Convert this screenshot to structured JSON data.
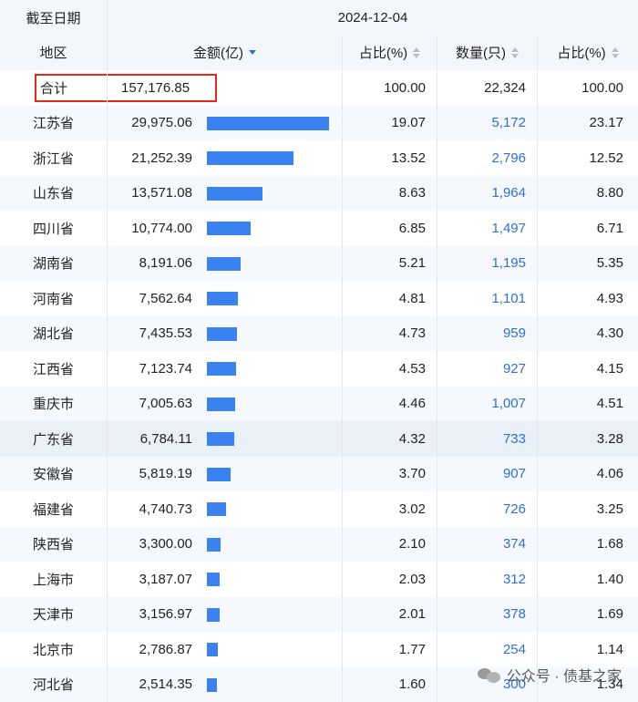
{
  "header": {
    "date_label": "截至日期",
    "date_value": "2024-12-04",
    "col_region": "地区",
    "col_amount": "金额(亿)",
    "col_share1": "占比(%)",
    "col_count": "数量(只)",
    "col_share2": "占比(%)"
  },
  "total": {
    "label": "合计",
    "amount": "157,176.85",
    "share1": "100.00",
    "count": "22,324",
    "share2": "100.00"
  },
  "bar_color": "#3a82f0",
  "rows": [
    {
      "region": "江苏省",
      "amount": "29,975.06",
      "amount_num": 29975.06,
      "share1": "19.07",
      "count": "5,172",
      "share2": "23.17"
    },
    {
      "region": "浙江省",
      "amount": "21,252.39",
      "amount_num": 21252.39,
      "share1": "13.52",
      "count": "2,796",
      "share2": "12.52"
    },
    {
      "region": "山东省",
      "amount": "13,571.08",
      "amount_num": 13571.08,
      "share1": "8.63",
      "count": "1,964",
      "share2": "8.80"
    },
    {
      "region": "四川省",
      "amount": "10,774.00",
      "amount_num": 10774.0,
      "share1": "6.85",
      "count": "1,497",
      "share2": "6.71"
    },
    {
      "region": "湖南省",
      "amount": "8,191.06",
      "amount_num": 8191.06,
      "share1": "5.21",
      "count": "1,195",
      "share2": "5.35"
    },
    {
      "region": "河南省",
      "amount": "7,562.64",
      "amount_num": 7562.64,
      "share1": "4.81",
      "count": "1,101",
      "share2": "4.93"
    },
    {
      "region": "湖北省",
      "amount": "7,435.53",
      "amount_num": 7435.53,
      "share1": "4.73",
      "count": "959",
      "share2": "4.30"
    },
    {
      "region": "江西省",
      "amount": "7,123.74",
      "amount_num": 7123.74,
      "share1": "4.53",
      "count": "927",
      "share2": "4.15"
    },
    {
      "region": "重庆市",
      "amount": "7,005.63",
      "amount_num": 7005.63,
      "share1": "4.46",
      "count": "1,007",
      "share2": "4.51"
    },
    {
      "region": "广东省",
      "amount": "6,784.11",
      "amount_num": 6784.11,
      "share1": "4.32",
      "count": "733",
      "share2": "3.28"
    },
    {
      "region": "安徽省",
      "amount": "5,819.19",
      "amount_num": 5819.19,
      "share1": "3.70",
      "count": "907",
      "share2": "4.06"
    },
    {
      "region": "福建省",
      "amount": "4,740.73",
      "amount_num": 4740.73,
      "share1": "3.02",
      "count": "726",
      "share2": "3.25"
    },
    {
      "region": "陕西省",
      "amount": "3,300.00",
      "amount_num": 3300.0,
      "share1": "2.10",
      "count": "374",
      "share2": "1.68"
    },
    {
      "region": "上海市",
      "amount": "3,187.07",
      "amount_num": 3187.07,
      "share1": "2.03",
      "count": "312",
      "share2": "1.40"
    },
    {
      "region": "天津市",
      "amount": "3,156.97",
      "amount_num": 3156.97,
      "share1": "2.01",
      "count": "378",
      "share2": "1.69"
    },
    {
      "region": "北京市",
      "amount": "2,786.87",
      "amount_num": 2786.87,
      "share1": "1.77",
      "count": "254",
      "share2": "1.14"
    },
    {
      "region": "河北省",
      "amount": "2,514.35",
      "amount_num": 2514.35,
      "share1": "1.60",
      "count": "300",
      "share2": "1.34"
    }
  ],
  "watermark": "公众号 · 债基之家",
  "watermark_icon": "wechat-icon"
}
